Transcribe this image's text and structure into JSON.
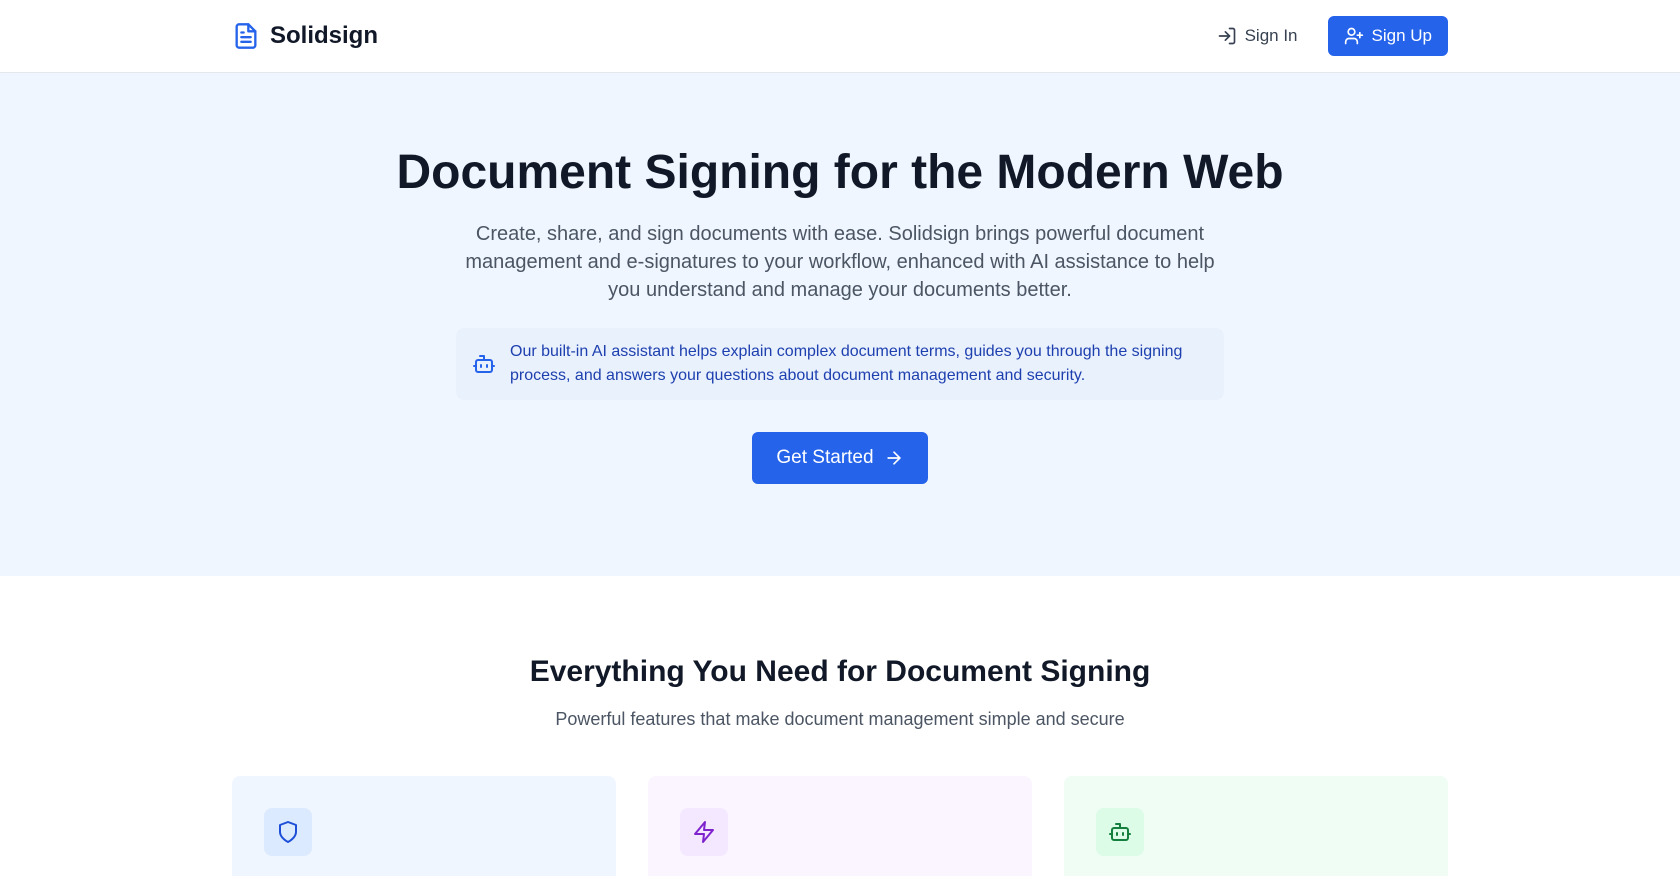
{
  "colors": {
    "primary": "#2563eb",
    "hero_bg": "#eff6ff",
    "ai_text": "#1e40af",
    "card_blue_icon": "#1d4ed8",
    "card_purple_icon": "#7e22ce",
    "card_green_icon": "#15803d"
  },
  "nav": {
    "brand": "Solidsign",
    "brand_icon": "file-text-icon",
    "sign_in": "Sign In",
    "sign_in_icon": "log-in-icon",
    "sign_up": "Sign Up",
    "sign_up_icon": "user-plus-icon"
  },
  "hero": {
    "title": "Document Signing for the Modern Web",
    "subtitle": "Create, share, and sign documents with ease. Solidsign brings powerful document management and e-signatures to your workflow, enhanced with AI assistance to help you understand and manage your documents better.",
    "ai_note": "Our built-in AI assistant helps explain complex document terms, guides you through the signing process, and answers your questions about document management and security.",
    "ai_icon": "bot-icon",
    "cta": "Get Started",
    "cta_icon": "arrow-right-icon"
  },
  "features": {
    "title": "Everything You Need for Document Signing",
    "subtitle": "Powerful features that make document management simple and secure",
    "cards": [
      {
        "icon": "shield-icon",
        "tone": "blue"
      },
      {
        "icon": "zap-icon",
        "tone": "purple"
      },
      {
        "icon": "bot-icon",
        "tone": "green"
      }
    ]
  }
}
